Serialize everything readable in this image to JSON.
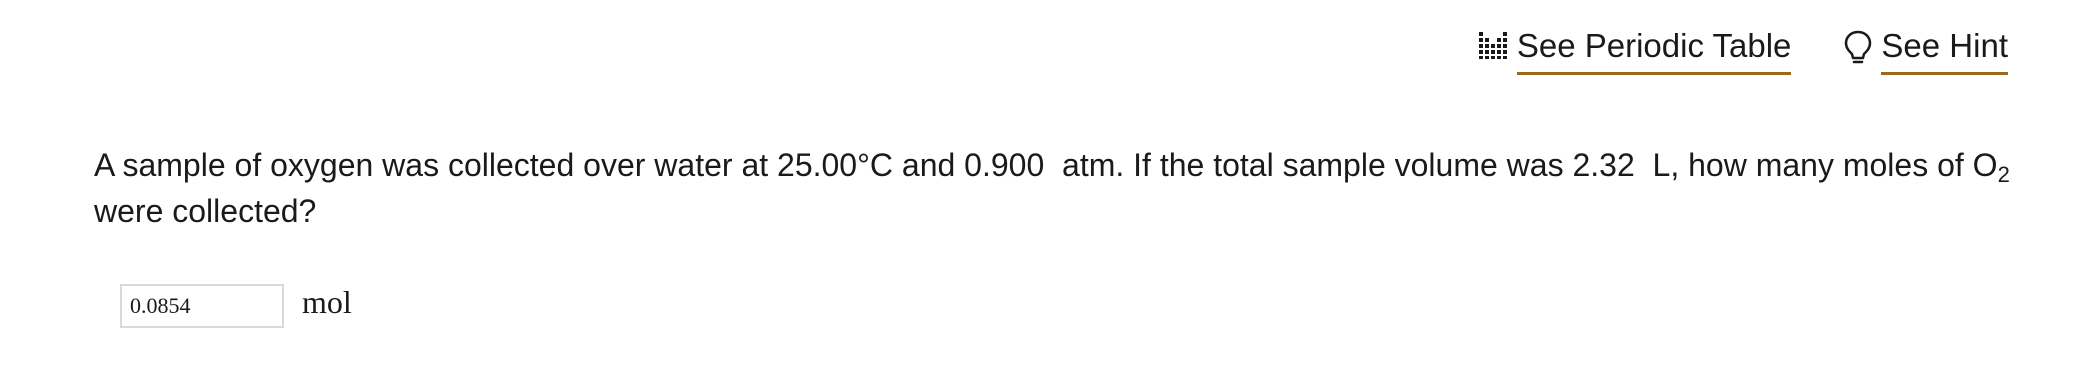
{
  "tools": {
    "periodic_table_label": "See Periodic Table",
    "periodic_table_icon": "periodic-table-icon",
    "hint_label": "See Hint",
    "hint_icon": "lightbulb-icon",
    "underline_color": "#9a6a1c"
  },
  "question": {
    "text_before_sub": "A sample of oxygen was collected over water at 25.00°C and 0.900  atm. If the total sample volume was 2.32  L, how many moles of O",
    "subscript": "2",
    "text_after_sub": " were collected?"
  },
  "answer": {
    "value": "0.0854",
    "placeholder": "",
    "unit": "mol"
  }
}
